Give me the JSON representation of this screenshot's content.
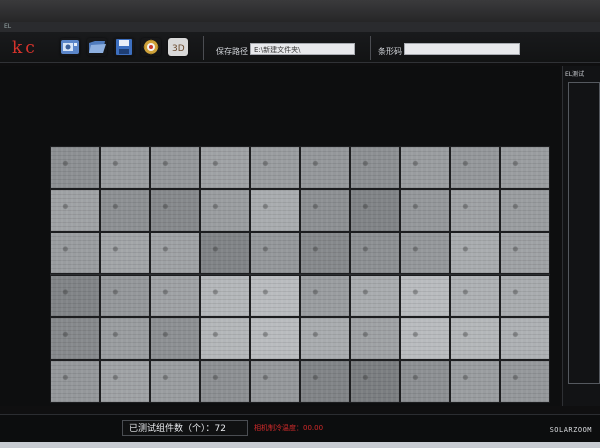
{
  "window": {
    "title": "EL"
  },
  "header": {
    "logo": "kc",
    "save_path_label": "保存路径",
    "save_path_value": "E:\\新建文件夹\\",
    "barcode_label": "条形码",
    "barcode_value": ""
  },
  "toolbar_icons": [
    "camera-icon",
    "folder-icon",
    "save-icon",
    "settings-gear-icon",
    "3d-view-icon"
  ],
  "right_panel": {
    "title": "EL测试"
  },
  "status": {
    "tested_count_label": "已测试组件数（个）：",
    "tested_count_value": "72",
    "temp_label": "相机制冷温度：00.00"
  },
  "watermark": "SOLARZOOM",
  "colors": {
    "logo": "#d6332c",
    "temp_text": "#d22a2a",
    "background": "#0f0f10"
  },
  "image": {
    "rows": 6,
    "cols": 10
  }
}
